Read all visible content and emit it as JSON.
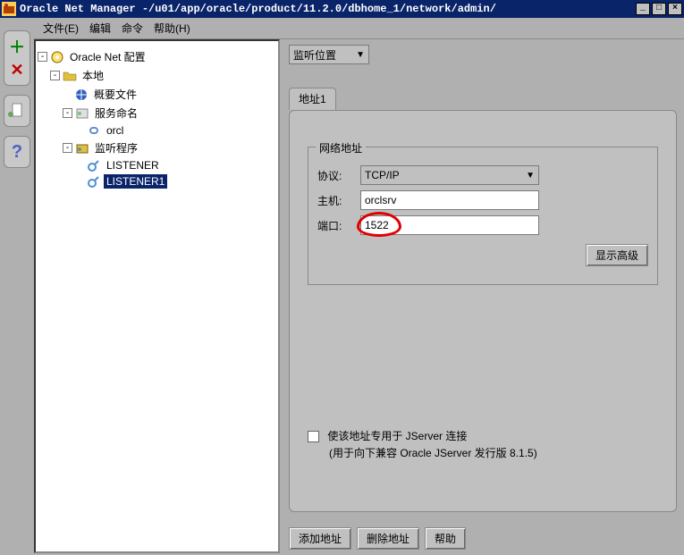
{
  "title_prefix": "Oracle Net Manager - ",
  "title_path": "/u01/app/oracle/product/11.2.0/dbhome_1/network/admin/",
  "menu": {
    "file": "文件(E)",
    "edit": "编辑",
    "command": "命令",
    "help": "帮助(H)"
  },
  "tree": {
    "root": "Oracle Net 配置",
    "local": "本地",
    "profile": "概要文件",
    "servicenaming": "服务命名",
    "servicechild": "orcl",
    "listeners": "监听程序",
    "listener0": "LISTENER",
    "listener1": "LISTENER1"
  },
  "right": {
    "listensel": "监听位置",
    "tab1": "地址1",
    "groupTitle": "网络地址",
    "protocolLabel": "协议:",
    "protocolValue": "TCP/IP",
    "hostLabel": "主机:",
    "hostValue": "orclsrv",
    "portLabel": "端口:",
    "portValue": "1522",
    "advanced": "显示高级",
    "jserverCheck": "使该地址专用于 JServer 连接",
    "jserverNote": "(用于向下兼容 Oracle JServer 发行版 8.1.5)",
    "addAddr": "添加地址",
    "delAddr": "删除地址",
    "helpBtn": "帮助"
  }
}
